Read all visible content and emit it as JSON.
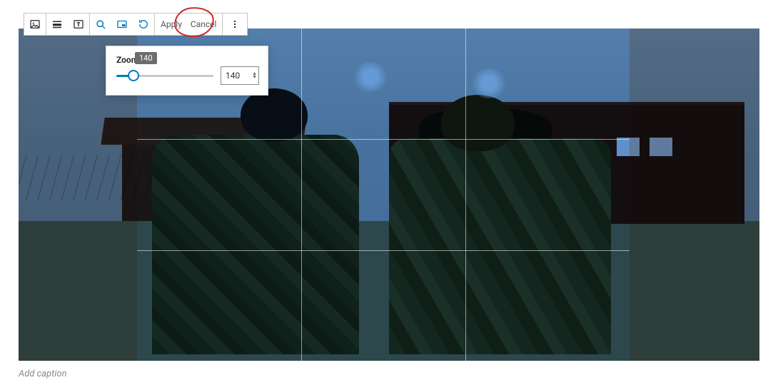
{
  "toolbar": {
    "apply_label": "Apply",
    "cancel_label": "Cancel"
  },
  "zoom": {
    "label": "Zoom",
    "tooltip": "140",
    "value": "140",
    "min": 100,
    "max": 300,
    "percent_of_track": 18
  },
  "caption": {
    "placeholder": "Add caption"
  }
}
